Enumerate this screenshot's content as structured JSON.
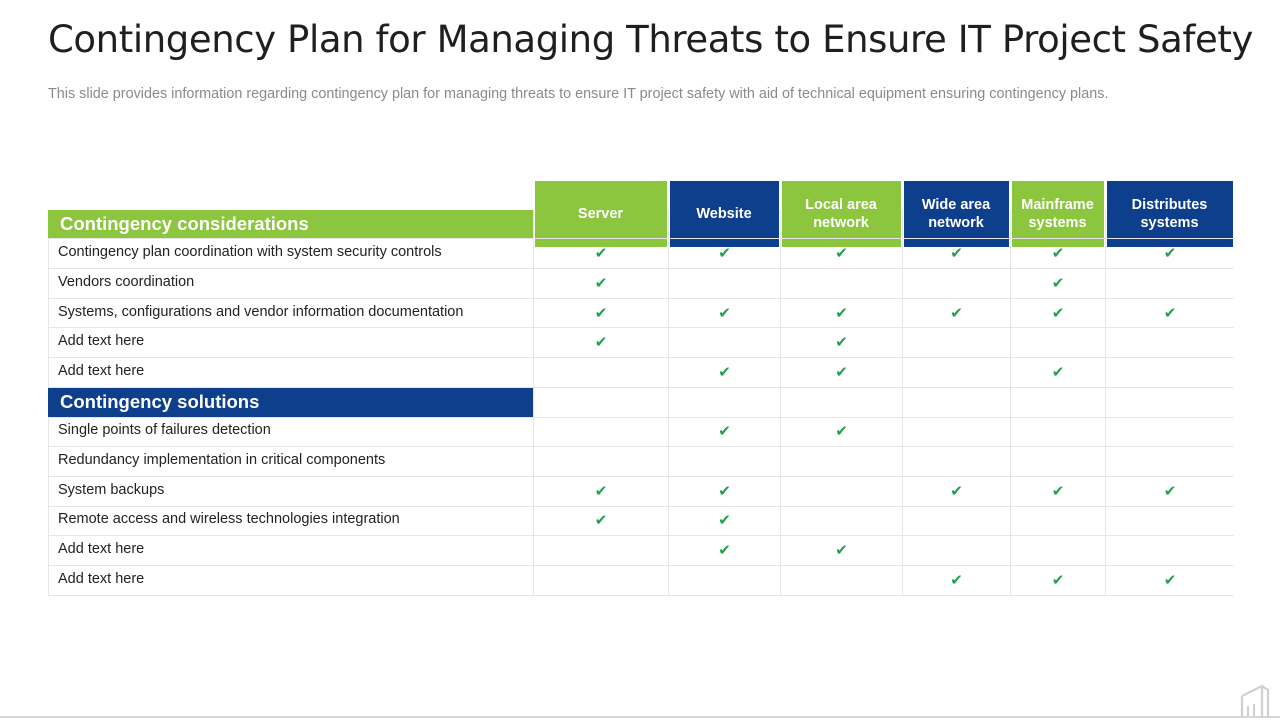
{
  "title": "Contingency Plan for Managing Threats to Ensure IT Project Safety",
  "subtitle": "This slide provides information regarding contingency plan for managing threats to ensure IT project safety with aid of technical equipment ensuring contingency plans.",
  "colors": {
    "green": "#8cc63f",
    "navy": "#0d3f8c",
    "check": "#1fa24a"
  },
  "columns": [
    {
      "label": "Server",
      "color": "green"
    },
    {
      "label": "Website",
      "color": "navy"
    },
    {
      "label": "Local area network",
      "color": "green"
    },
    {
      "label": "Wide area network",
      "color": "navy"
    },
    {
      "label": "Mainframe systems",
      "color": "green"
    },
    {
      "label": "Distributes systems",
      "color": "navy"
    }
  ],
  "check_icon": "check-icon",
  "sections": [
    {
      "label": "Contingency considerations",
      "color": "green",
      "rows": [
        {
          "label": "Contingency plan coordination with system security controls",
          "checks": [
            true,
            true,
            true,
            true,
            true,
            true
          ]
        },
        {
          "label": "Vendors coordination",
          "checks": [
            true,
            false,
            false,
            false,
            true,
            false
          ]
        },
        {
          "label": "Systems, configurations and vendor information documentation",
          "checks": [
            true,
            true,
            true,
            true,
            true,
            true
          ]
        },
        {
          "label": "Add text here",
          "checks": [
            true,
            false,
            true,
            false,
            false,
            false
          ]
        },
        {
          "label": "Add text here",
          "checks": [
            false,
            true,
            true,
            false,
            true,
            false
          ]
        }
      ]
    },
    {
      "label": "Contingency solutions",
      "color": "navy",
      "rows": [
        {
          "label": "Single points of failures detection",
          "checks": [
            false,
            true,
            true,
            false,
            false,
            false
          ]
        },
        {
          "label": "Redundancy implementation in critical components",
          "checks": [
            false,
            false,
            false,
            false,
            false,
            false
          ]
        },
        {
          "label": "System backups",
          "checks": [
            true,
            true,
            false,
            true,
            true,
            true
          ]
        },
        {
          "label": "Remote access and wireless technologies integration",
          "checks": [
            true,
            true,
            false,
            false,
            false,
            false
          ]
        },
        {
          "label": "Add text here",
          "checks": [
            false,
            true,
            true,
            false,
            false,
            false
          ]
        },
        {
          "label": "Add text here",
          "checks": [
            false,
            false,
            false,
            true,
            true,
            true
          ]
        }
      ]
    }
  ]
}
